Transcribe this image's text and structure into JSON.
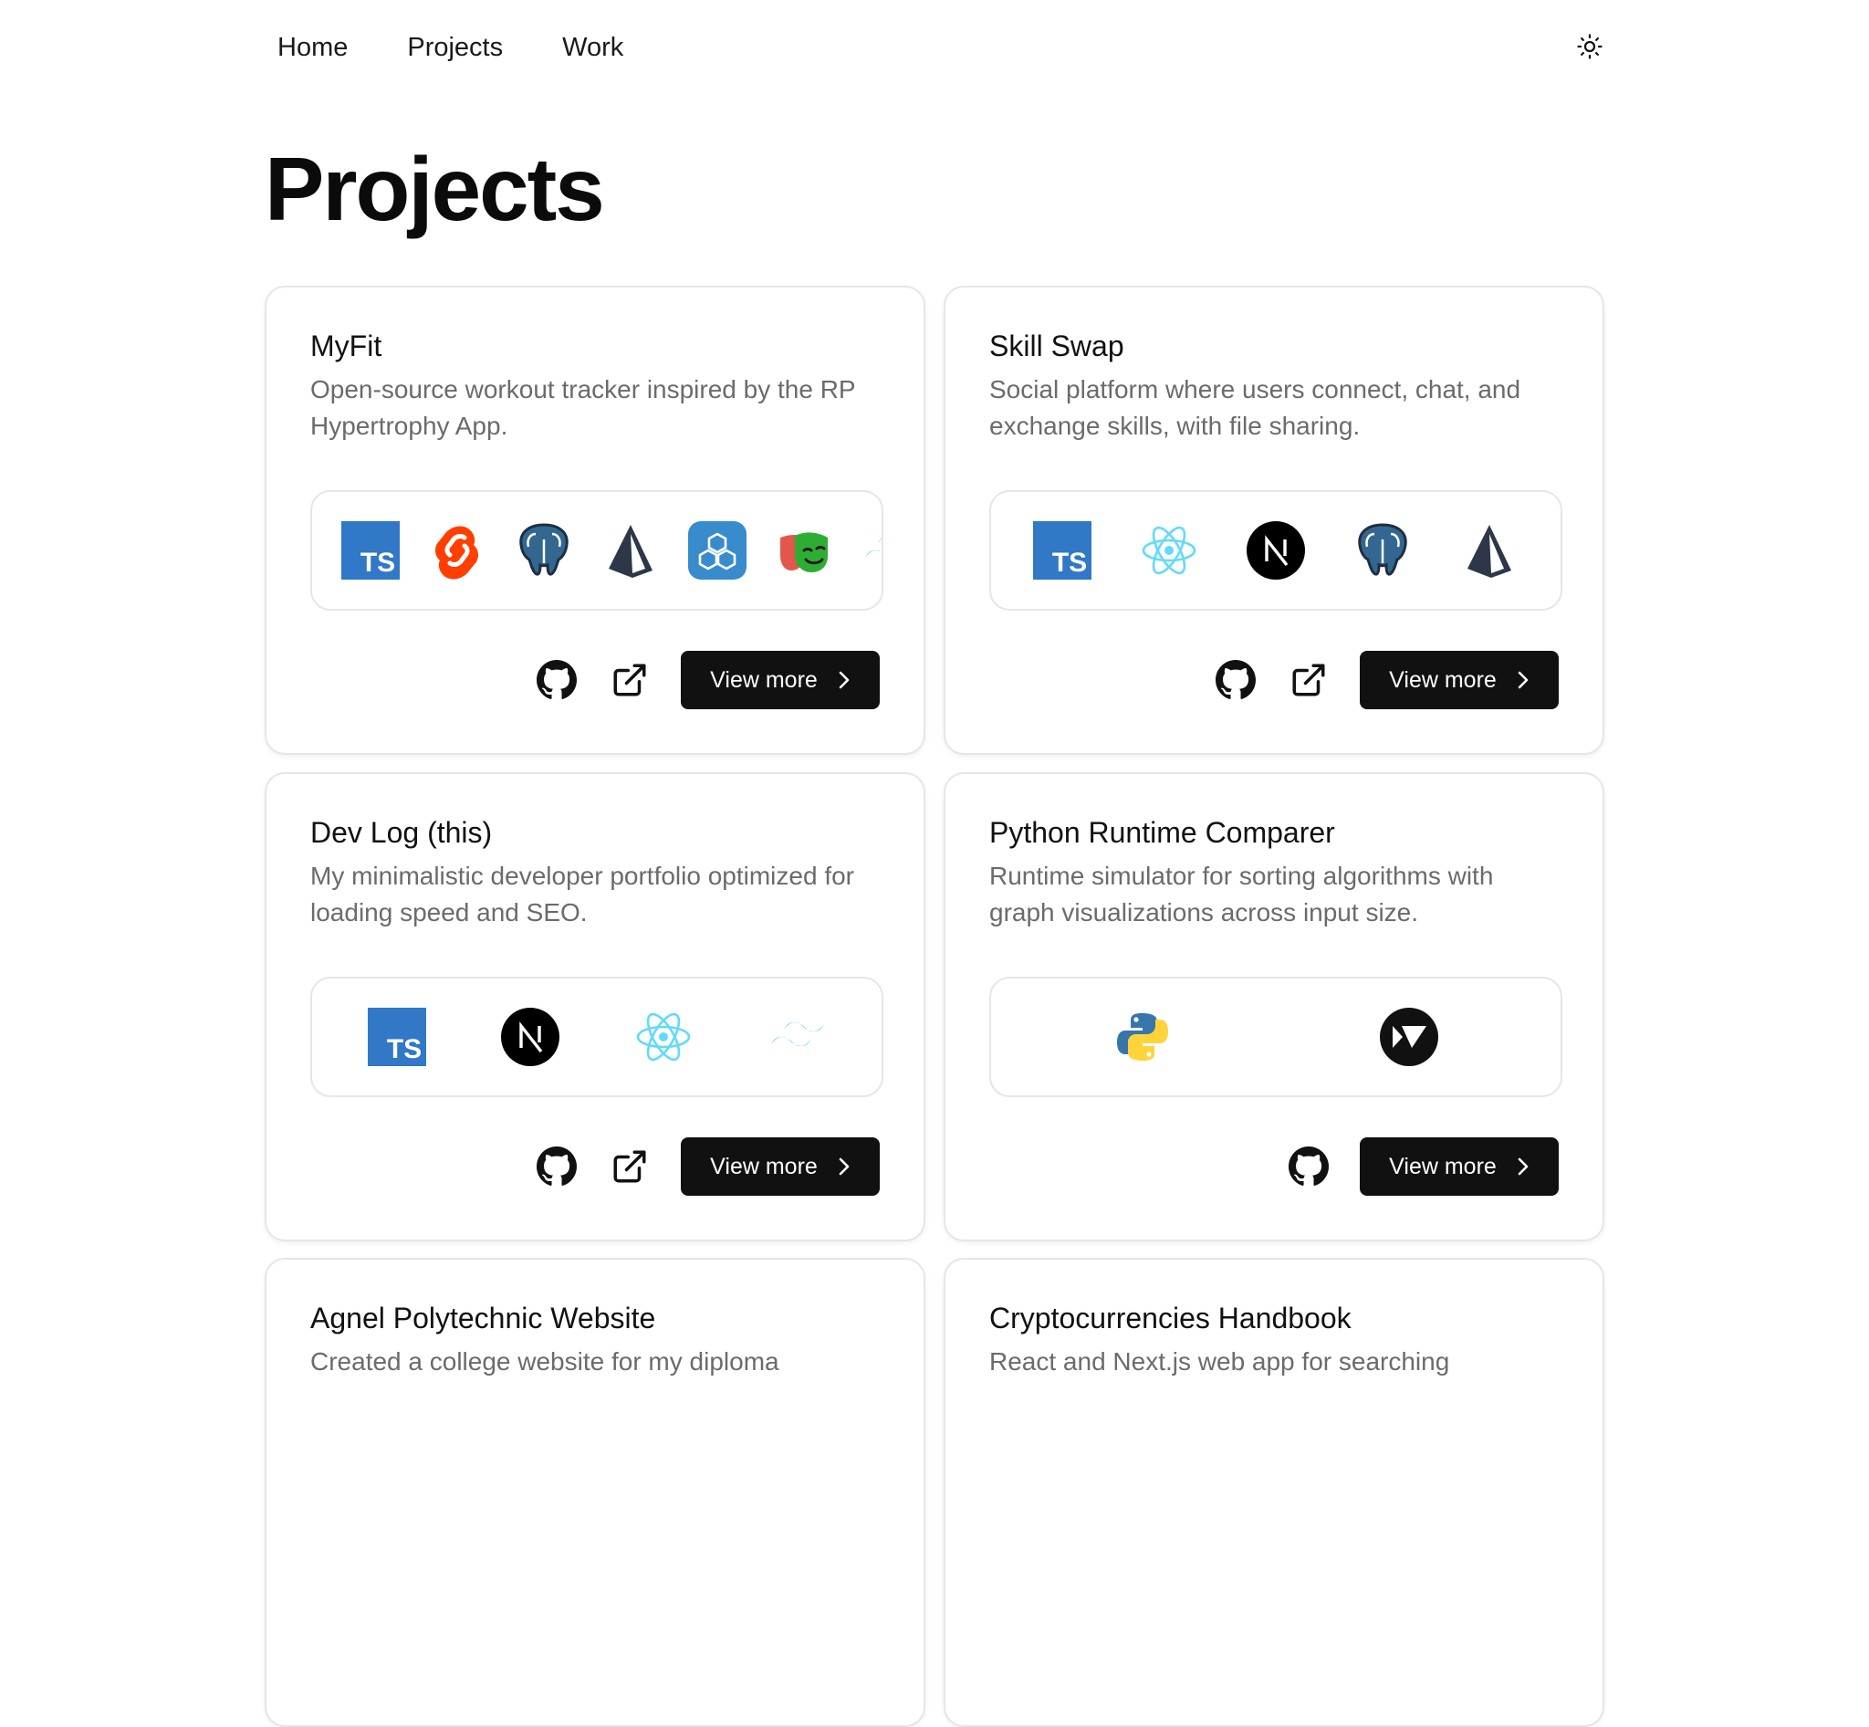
{
  "nav": {
    "items": [
      "Home",
      "Projects",
      "Work"
    ]
  },
  "page": {
    "title": "Projects"
  },
  "projects": [
    {
      "title": "MyFit",
      "description": "Open-source workout tracker inspired by the RP Hypertrophy App.",
      "tech": [
        "typescript-icon",
        "svelte-icon",
        "postgresql-icon",
        "prisma-icon",
        "trpc-icon",
        "playwright-icon",
        "tailwind-icon"
      ],
      "links": [
        "github-icon",
        "external-link-icon"
      ],
      "view_more_label": "View more"
    },
    {
      "title": "Skill Swap",
      "description": "Social platform where users connect, chat, and exchange skills, with file sharing.",
      "tech": [
        "typescript-icon",
        "react-icon",
        "nextjs-icon",
        "postgresql-icon",
        "prisma-icon"
      ],
      "links": [
        "github-icon",
        "external-link-icon"
      ],
      "view_more_label": "View more"
    },
    {
      "title": "Dev Log (this)",
      "description": "My minimalistic developer portfolio optimized for loading speed and SEO.",
      "tech": [
        "typescript-icon",
        "nextjs-icon",
        "react-icon",
        "tailwind-icon"
      ],
      "links": [
        "github-icon",
        "external-link-icon"
      ],
      "view_more_label": "View more"
    },
    {
      "title": "Python Runtime Comparer",
      "description": "Runtime simulator for sorting algorithms with graph visualizations across input size.",
      "tech": [
        "python-icon",
        "kivy-icon"
      ],
      "links": [
        "github-icon"
      ],
      "view_more_label": "View more"
    },
    {
      "title": "Agnel Polytechnic Website",
      "description": "Created a college website for my diploma"
    },
    {
      "title": "Cryptocurrencies Handbook",
      "description": "React and Next.js web app for searching"
    }
  ]
}
